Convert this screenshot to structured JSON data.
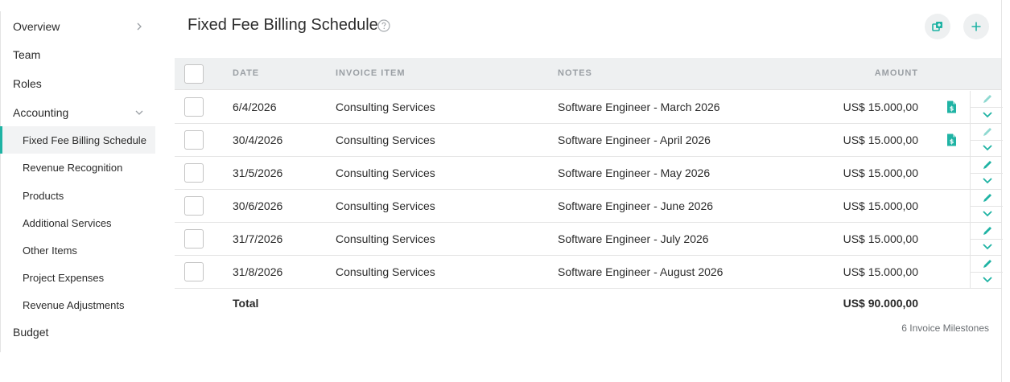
{
  "sidebar": {
    "items": [
      {
        "label": "Overview"
      },
      {
        "label": "Team"
      },
      {
        "label": "Roles"
      },
      {
        "label": "Accounting"
      },
      {
        "label": "Fixed Fee Billing Schedule"
      },
      {
        "label": "Revenue Recognition"
      },
      {
        "label": "Products"
      },
      {
        "label": "Additional Services"
      },
      {
        "label": "Other Items"
      },
      {
        "label": "Project Expenses"
      },
      {
        "label": "Revenue Adjustments"
      },
      {
        "label": "Budget"
      }
    ],
    "active_item": "Fixed Fee Billing Schedule"
  },
  "header": {
    "title": "Fixed Fee Billing Schedule",
    "help_icon": "question-circle-icon",
    "actions": [
      "copy-icon",
      "plus-icon"
    ]
  },
  "table": {
    "columns": [
      "DATE",
      "INVOICE ITEM",
      "NOTES",
      "AMOUNT"
    ],
    "rows": [
      {
        "date": "6/4/2026",
        "item": "Consulting Services",
        "notes": "Software Engineer - March 2026",
        "amount": "US$ 15.000,00",
        "has_invoice": true,
        "edit_enabled": false
      },
      {
        "date": "30/4/2026",
        "item": "Consulting Services",
        "notes": "Software Engineer - April 2026",
        "amount": "US$ 15.000,00",
        "has_invoice": true,
        "edit_enabled": false
      },
      {
        "date": "31/5/2026",
        "item": "Consulting Services",
        "notes": "Software Engineer - May 2026",
        "amount": "US$ 15.000,00",
        "has_invoice": false,
        "edit_enabled": true
      },
      {
        "date": "30/6/2026",
        "item": "Consulting Services",
        "notes": "Software Engineer - June 2026",
        "amount": "US$ 15.000,00",
        "has_invoice": false,
        "edit_enabled": true
      },
      {
        "date": "31/7/2026",
        "item": "Consulting Services",
        "notes": "Software Engineer - July 2026",
        "amount": "US$ 15.000,00",
        "has_invoice": false,
        "edit_enabled": true
      },
      {
        "date": "31/8/2026",
        "item": "Consulting Services",
        "notes": "Software Engineer - August 2026",
        "amount": "US$ 15.000,00",
        "has_invoice": false,
        "edit_enabled": true
      }
    ],
    "total_label": "Total",
    "total_amount": "US$ 90.000,00",
    "footer_note": "6 Invoice Milestones"
  },
  "colors": {
    "accent": "#1fb3a4",
    "accent_light": "#8fd9d1",
    "header_bg": "#eef0f1",
    "active_nav_bg": "#f2f3f4"
  }
}
